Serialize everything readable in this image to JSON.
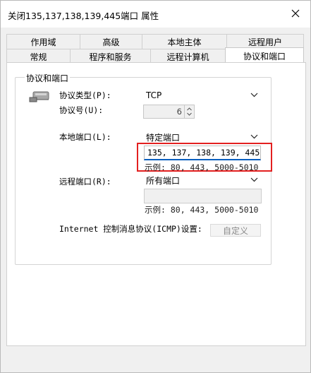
{
  "window": {
    "title": "关闭135,137,138,139,445端口 属性"
  },
  "tabs_row1": [
    "作用域",
    "高级",
    "本地主体",
    "远程用户"
  ],
  "tabs_row2": [
    "常规",
    "程序和服务",
    "远程计算机",
    "协议和端口"
  ],
  "active_tab": "协议和端口",
  "group": {
    "title": "协议和端口",
    "protocol_type_label": "协议类型(P):",
    "protocol_type_value": "TCP",
    "protocol_number_label": "协议号(U):",
    "protocol_number_value": "6",
    "local_port_label": "本地端口(L):",
    "local_port_select": "特定端口",
    "local_port_value": "135, 137, 138, 139, 445",
    "local_port_example": "示例: 80, 443, 5000-5010",
    "remote_port_label": "远程端口(R):",
    "remote_port_select": "所有端口",
    "remote_port_value": "",
    "remote_port_example": "示例: 80, 443, 5000-5010",
    "icmp_label": "Internet 控制消息协议(ICMP)设置:",
    "customize_button": "自定义"
  },
  "colors": {
    "highlight_border": "#e32020",
    "focus_underline": "#0a5fbf"
  }
}
